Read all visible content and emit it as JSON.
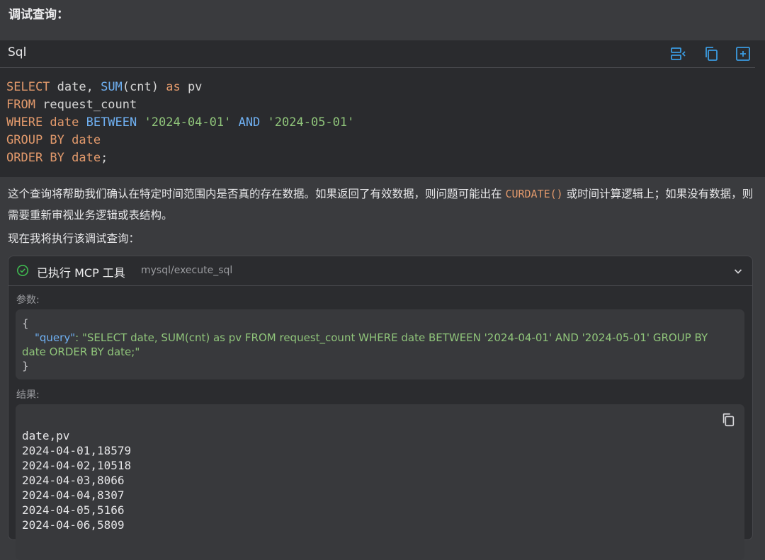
{
  "heading": "调试查询：",
  "code_block": {
    "language": "Sql",
    "icons": [
      "collapse-panel-icon",
      "copy-icon",
      "insert-icon"
    ],
    "lines": [
      [
        {
          "t": "SELECT",
          "c": "kw"
        },
        {
          "t": " date, ",
          "c": "plain"
        },
        {
          "t": "SUM",
          "c": "fn"
        },
        {
          "t": "(cnt) ",
          "c": "plain"
        },
        {
          "t": "as",
          "c": "kw"
        },
        {
          "t": " pv",
          "c": "plain"
        }
      ],
      [
        {
          "t": "FROM",
          "c": "kw"
        },
        {
          "t": " request_count",
          "c": "plain"
        }
      ],
      [
        {
          "t": "WHERE date ",
          "c": "kw"
        },
        {
          "t": "BETWEEN",
          "c": "fn"
        },
        {
          "t": " ",
          "c": "plain"
        },
        {
          "t": "'2024-04-01'",
          "c": "str"
        },
        {
          "t": " ",
          "c": "plain"
        },
        {
          "t": "AND",
          "c": "fn"
        },
        {
          "t": " ",
          "c": "plain"
        },
        {
          "t": "'2024-05-01'",
          "c": "str"
        }
      ],
      [
        {
          "t": "GROUP BY date",
          "c": "kw"
        }
      ],
      [
        {
          "t": "ORDER BY date",
          "c": "kw"
        },
        {
          "t": ";",
          "c": "plain"
        }
      ]
    ]
  },
  "explanation": {
    "before": "这个查询将帮助我们确认在特定时间范围内是否真的存在数据。如果返回了有效数据，则问题可能出在 ",
    "code": "CURDATE()",
    "after": " 或时间计算逻辑上；如果没有数据，则需要重新审视业务逻辑或表结构。"
  },
  "next_step": "现在我将执行该调试查询：",
  "tool_call": {
    "status_icon": "check-circle-icon",
    "title": "已执行 MCP 工具",
    "tool_name": "mysql/execute_sql",
    "params_label": "参数:",
    "params": {
      "open": "{",
      "key": "\"query\"",
      "sep": ": ",
      "value": "\"SELECT date, SUM(cnt) as pv FROM request_count WHERE date BETWEEN '2024-04-01' AND '2024-05-01' GROUP BY date ORDER BY date;\"",
      "close": "}"
    },
    "result_label": "结果:",
    "result_lines": [
      "date,pv",
      "2024-04-01,18579",
      "2024-04-02,10518",
      "2024-04-03,8066",
      "2024-04-04,8307",
      "2024-04-05,5166",
      "2024-04-06,5809"
    ]
  },
  "colors": {
    "keyword": "#e39a6c",
    "function": "#6fb0f2",
    "string": "#8fc47a",
    "success": "#3fb950",
    "icon_accent": "#3b9be0"
  }
}
